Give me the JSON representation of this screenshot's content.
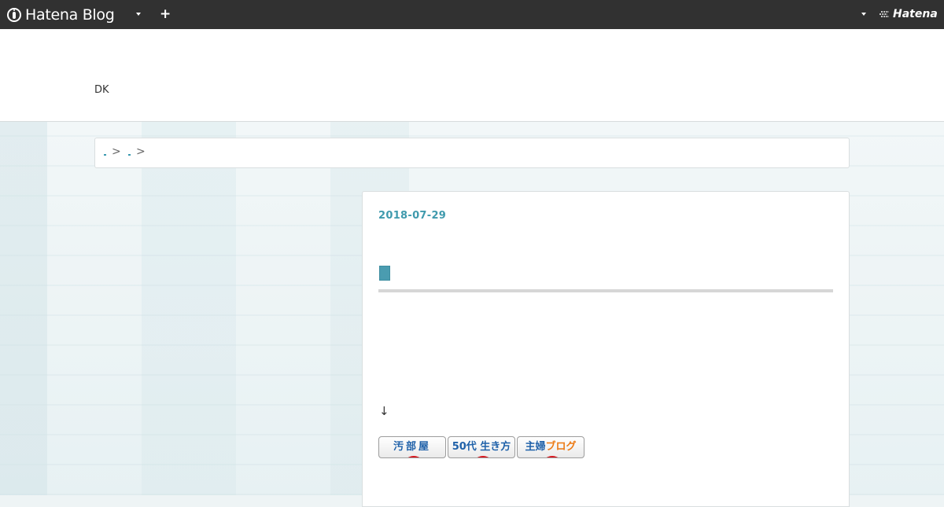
{
  "topbar": {
    "logo_text": "Hatena Blog",
    "add_label": "+",
    "hatena_label": "Hatena"
  },
  "header": {
    "blog_title": "DK"
  },
  "breadcrumb": {
    "separator": ">"
  },
  "article": {
    "date": "2018-07-29",
    "arrow": "↓",
    "banners": [
      {
        "text": "汚部屋"
      },
      {
        "text": "50代 生き方"
      },
      {
        "text_a": "主婦",
        "text_b": "ブログ"
      }
    ]
  },
  "colors": {
    "topbar": "#313131",
    "accent": "#3f9aad",
    "banner_blue": "#1f61a9",
    "banner_orange": "#ec7a14",
    "banner_red": "#d8141b"
  },
  "icons": [
    "hatena-blog-logo-icon",
    "chevron-down-icon",
    "plus-icon",
    "hatena-logo-icon"
  ]
}
